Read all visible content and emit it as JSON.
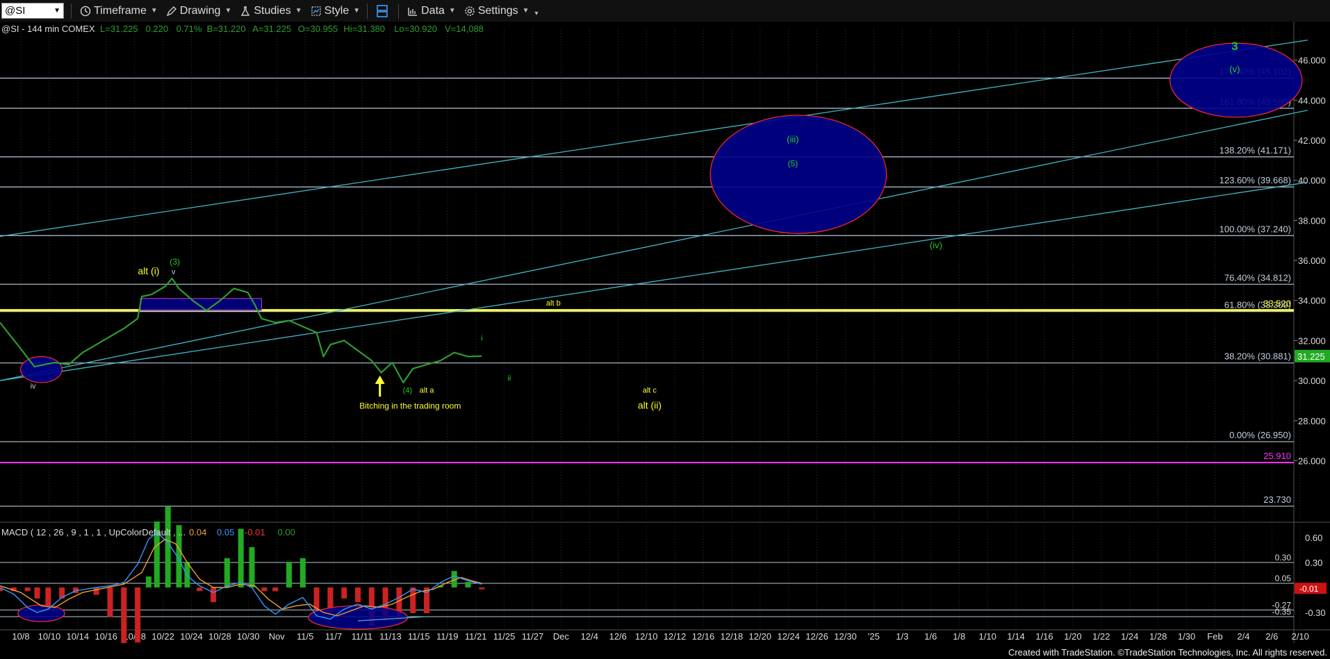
{
  "toolbar": {
    "symbol": "@SI",
    "timeframe_label": "Timeframe",
    "drawing_label": "Drawing",
    "studies_label": "Studies",
    "style_label": "Style",
    "data_label": "Data",
    "settings_label": "Settings"
  },
  "footer": "Created with TradeStation. ©TradeStation Technologies, Inc. All rights reserved.",
  "colors": {
    "bg": "#000000",
    "price": "#2e9e2e",
    "fib": "#b8c8d8",
    "channel": "#3fb8c8",
    "yellow": "#ffff33",
    "magenta": "#ff33ff",
    "ellipse_fill": "#00008b",
    "ellipse_stroke": "#ff2a2a",
    "macd": "#3399ff",
    "signal": "#f0a030"
  },
  "chart_data": [
    {
      "type": "line",
      "header": "@SI - 144 min  COMEX",
      "quote": [
        {
          "label": "L=31.225",
          "color": "#2e9e2e"
        },
        {
          "label": "0.220",
          "color": "#2e9e2e"
        },
        {
          "label": "0.71%",
          "color": "#2e9e2e"
        },
        {
          "label": "B=31.220",
          "color": "#2e9e2e"
        },
        {
          "label": "A=31.225",
          "color": "#2e9e2e"
        },
        {
          "label": "O=30.955",
          "color": "#2e9e2e"
        },
        {
          "label": "Hi=31.380",
          "color": "#2e9e2e"
        },
        {
          "label": "Lo=30.920",
          "color": "#2e9e2e"
        },
        {
          "label": "V=14,088",
          "color": "#2e9e2e"
        }
      ],
      "y_ticks": [
        "46.000",
        "44.000",
        "42.000",
        "40.000",
        "38.000",
        "36.000",
        "34.000",
        "32.000",
        "30.000",
        "28.000",
        "26.000"
      ],
      "ylim": [
        23.0,
        47.2
      ],
      "x_ticks": [
        "10/8",
        "10/10",
        "10/14",
        "10/16",
        "10/18",
        "10/22",
        "10/24",
        "10/28",
        "10/30",
        "Nov",
        "11/5",
        "11/7",
        "11/11",
        "11/13",
        "11/15",
        "11/19",
        "11/21",
        "11/25",
        "11/27",
        "Dec",
        "12/4",
        "12/6",
        "12/10",
        "12/12",
        "12/16",
        "12/18",
        "12/20",
        "12/24",
        "12/26",
        "12/30",
        "'25",
        "1/3",
        "1/6",
        "1/8",
        "1/10",
        "1/14",
        "1/16",
        "1/20",
        "1/22",
        "1/24",
        "1/28",
        "1/30",
        "Feb",
        "2/4",
        "2/6",
        "2/10"
      ],
      "last_price": "31.225",
      "price": [
        {
          "x": 0,
          "y": 32.9
        },
        {
          "x": 1.5,
          "y": 31.6
        },
        {
          "x": 2.5,
          "y": 30.7
        },
        {
          "x": 4,
          "y": 30.9
        },
        {
          "x": 5,
          "y": 30.8
        },
        {
          "x": 6,
          "y": 31.4
        },
        {
          "x": 7,
          "y": 31.8
        },
        {
          "x": 8,
          "y": 32.2
        },
        {
          "x": 9,
          "y": 32.6
        },
        {
          "x": 10,
          "y": 33.1
        },
        {
          "x": 10.3,
          "y": 34.2
        },
        {
          "x": 11,
          "y": 34.3
        },
        {
          "x": 12,
          "y": 34.7
        },
        {
          "x": 12.5,
          "y": 35.1
        },
        {
          "x": 13,
          "y": 34.6
        },
        {
          "x": 14,
          "y": 34.0
        },
        {
          "x": 15,
          "y": 33.5
        },
        {
          "x": 16,
          "y": 34.0
        },
        {
          "x": 17,
          "y": 34.6
        },
        {
          "x": 18,
          "y": 34.4
        },
        {
          "x": 18.5,
          "y": 33.8
        },
        {
          "x": 19,
          "y": 33.1
        },
        {
          "x": 20,
          "y": 32.9
        },
        {
          "x": 21,
          "y": 33.0
        },
        {
          "x": 22,
          "y": 32.7
        },
        {
          "x": 23,
          "y": 32.4
        },
        {
          "x": 23.5,
          "y": 31.2
        },
        {
          "x": 24,
          "y": 31.8
        },
        {
          "x": 25,
          "y": 32.0
        },
        {
          "x": 26,
          "y": 31.5
        },
        {
          "x": 27,
          "y": 31.0
        },
        {
          "x": 27.7,
          "y": 30.4
        },
        {
          "x": 28.5,
          "y": 30.9
        },
        {
          "x": 29.3,
          "y": 29.9
        },
        {
          "x": 30,
          "y": 30.6
        },
        {
          "x": 31,
          "y": 30.8
        },
        {
          "x": 32,
          "y": 31.0
        },
        {
          "x": 33,
          "y": 31.4
        },
        {
          "x": 34,
          "y": 31.2
        },
        {
          "x": 35,
          "y": 31.225
        }
      ],
      "horizontal_levels": [
        {
          "label": "176.40% (45.102)",
          "value": 45.102,
          "color": "#b8c8d8"
        },
        {
          "label": "161.80% (43.599)",
          "value": 43.599,
          "color": "#b8c8d8"
        },
        {
          "label": "138.20% (41.171)",
          "value": 41.171,
          "color": "#b8c8d8"
        },
        {
          "label": "123.60% (39.668)",
          "value": 39.668,
          "color": "#b8c8d8"
        },
        {
          "label": "100.00% (37.240)",
          "value": 37.24,
          "color": "#b8c8d8"
        },
        {
          "label": "76.40% (34.812)",
          "value": 34.812,
          "color": "#b8c8d8"
        },
        {
          "label": "61.80% (33.309)",
          "value": 33.45,
          "color": "#b8c8d8"
        },
        {
          "label": "38.20% (30.881)",
          "value": 30.881,
          "color": "#b8c8d8"
        },
        {
          "label": "0.00% (26.950)",
          "value": 26.95,
          "color": "#b8c8d8"
        },
        {
          "label": "33.520",
          "value": 33.52,
          "color": "#ffff33"
        },
        {
          "label": "25.910",
          "value": 25.91,
          "color": "#ff33ff"
        },
        {
          "label": "23.730",
          "value": 23.73,
          "color": "#b8c8d8"
        }
      ],
      "channel_lines": [
        {
          "x1": 0,
          "y1": 37.2,
          "x2": 95,
          "y2": 47.0
        },
        {
          "x1": 0,
          "y1": 30.0,
          "x2": 95,
          "y2": 43.5
        },
        {
          "x1": 0,
          "y1": 30.0,
          "x2": 95,
          "y2": 39.9
        }
      ],
      "ellipses": [
        {
          "cx": 3.0,
          "cy": 30.55,
          "rx": 1.5,
          "ry": 0.65
        },
        {
          "cx": 58.0,
          "cy": 40.3,
          "rx": 6.4,
          "ry": 2.95
        },
        {
          "cx": 89.8,
          "cy": 45.0,
          "rx": 4.8,
          "ry": 1.85
        }
      ],
      "rectangle": {
        "x1": 10.2,
        "x2": 19.0,
        "y1": 33.5,
        "y2": 34.1
      },
      "annotations": [
        {
          "text": "3",
          "x": 89.7,
          "y": 46.5,
          "color": "#22cc22",
          "size": 17,
          "bold": true
        },
        {
          "text": "(v)",
          "x": 89.7,
          "y": 45.4,
          "color": "#22cc22",
          "size": 13
        },
        {
          "text": "(iii)",
          "x": 57.6,
          "y": 41.9,
          "color": "#22cc22",
          "size": 13
        },
        {
          "text": "(5)",
          "x": 57.6,
          "y": 40.7,
          "color": "#22cc22",
          "size": 12
        },
        {
          "text": "(iv)",
          "x": 68.0,
          "y": 36.6,
          "color": "#22cc22",
          "size": 13
        },
        {
          "text": "alt (i)",
          "x": 10.8,
          "y": 35.3,
          "color": "#ffff33",
          "size": 14
        },
        {
          "text": "(3)",
          "x": 12.7,
          "y": 35.8,
          "color": "#22cc22",
          "size": 12
        },
        {
          "text": "v",
          "x": 12.6,
          "y": 35.3,
          "color": "#ccc",
          "size": 11
        },
        {
          "text": "alt b",
          "x": 40.2,
          "y": 33.75,
          "color": "#ffff33",
          "size": 11
        },
        {
          "text": "i",
          "x": 35.0,
          "y": 32.0,
          "color": "#22cc22",
          "size": 11
        },
        {
          "text": "ii",
          "x": 37.0,
          "y": 30.0,
          "color": "#22cc22",
          "size": 11
        },
        {
          "text": "iv",
          "x": 2.4,
          "y": 29.6,
          "color": "#ccc",
          "size": 11
        },
        {
          "text": "(4)",
          "x": 29.6,
          "y": 29.4,
          "color": "#22cc22",
          "size": 11
        },
        {
          "text": "alt a",
          "x": 31.0,
          "y": 29.4,
          "color": "#ffff33",
          "size": 11
        },
        {
          "text": "alt c",
          "x": 47.2,
          "y": 29.4,
          "color": "#ffff33",
          "size": 11
        },
        {
          "text": "alt (ii)",
          "x": 47.2,
          "y": 28.6,
          "color": "#ffff33",
          "size": 14
        },
        {
          "text": "Bitching in the trading room",
          "x": 29.8,
          "y": 28.6,
          "color": "#ffff33",
          "size": 12
        }
      ],
      "arrow": {
        "x": 27.6,
        "y_from": 29.2,
        "y_to": 30.25
      }
    },
    {
      "type": "line",
      "header": "MACD ( 12 , 26 , 9 , 1 , 1 , UpColorDefault , ...",
      "readouts": [
        {
          "label": "0.04",
          "color": "#f0a030"
        },
        {
          "label": "0.05",
          "color": "#3399ff"
        },
        {
          "label": "-0.01",
          "color": "#ff3333"
        },
        {
          "label": "0.00",
          "color": "#2e9e2e"
        }
      ],
      "y_ticks": [
        "0.60",
        "0.30",
        "-0.30"
      ],
      "ylim": [
        -0.45,
        0.75
      ],
      "levels": [
        {
          "label": "0.30",
          "value": 0.3
        },
        {
          "label": "0.05",
          "value": 0.05
        },
        {
          "label": "-0.27",
          "value": -0.27
        },
        {
          "label": "-0.35",
          "value": -0.35
        }
      ],
      "last_value": "-0.01",
      "macd": [
        {
          "x": 0,
          "y": 0.0
        },
        {
          "x": 1,
          "y": -0.08
        },
        {
          "x": 2,
          "y": -0.24
        },
        {
          "x": 2.7,
          "y": -0.3
        },
        {
          "x": 3.5,
          "y": -0.26
        },
        {
          "x": 4.5,
          "y": -0.12
        },
        {
          "x": 5.5,
          "y": -0.04
        },
        {
          "x": 7,
          "y": 0.0
        },
        {
          "x": 8,
          "y": 0.02
        },
        {
          "x": 9,
          "y": 0.06
        },
        {
          "x": 10,
          "y": 0.28
        },
        {
          "x": 10.8,
          "y": 0.58
        },
        {
          "x": 11.4,
          "y": 0.66
        },
        {
          "x": 12.2,
          "y": 0.54
        },
        {
          "x": 13,
          "y": 0.34
        },
        {
          "x": 13.6,
          "y": 0.14
        },
        {
          "x": 14.5,
          "y": 0.02
        },
        {
          "x": 15.5,
          "y": -0.06
        },
        {
          "x": 16.5,
          "y": 0.02
        },
        {
          "x": 17.5,
          "y": 0.06
        },
        {
          "x": 18.3,
          "y": 0.0
        },
        {
          "x": 19.2,
          "y": -0.22
        },
        {
          "x": 20,
          "y": -0.32
        },
        {
          "x": 21,
          "y": -0.2
        },
        {
          "x": 22,
          "y": -0.12
        },
        {
          "x": 23,
          "y": -0.34
        },
        {
          "x": 24,
          "y": -0.38
        },
        {
          "x": 25,
          "y": -0.26
        },
        {
          "x": 26,
          "y": -0.2
        },
        {
          "x": 27,
          "y": -0.26
        },
        {
          "x": 28,
          "y": -0.2
        },
        {
          "x": 29,
          "y": -0.12
        },
        {
          "x": 30,
          "y": -0.02
        },
        {
          "x": 31,
          "y": -0.06
        },
        {
          "x": 32,
          "y": 0.06
        },
        {
          "x": 33,
          "y": 0.14
        },
        {
          "x": 34,
          "y": 0.08
        },
        {
          "x": 35,
          "y": 0.04
        }
      ],
      "signal": [
        {
          "x": 0,
          "y": 0.02
        },
        {
          "x": 1.5,
          "y": -0.06
        },
        {
          "x": 3,
          "y": -0.22
        },
        {
          "x": 4,
          "y": -0.24
        },
        {
          "x": 5,
          "y": -0.14
        },
        {
          "x": 6,
          "y": -0.06
        },
        {
          "x": 7.5,
          "y": -0.01
        },
        {
          "x": 9,
          "y": 0.04
        },
        {
          "x": 10.3,
          "y": 0.18
        },
        {
          "x": 11.2,
          "y": 0.48
        },
        {
          "x": 12,
          "y": 0.58
        },
        {
          "x": 12.8,
          "y": 0.52
        },
        {
          "x": 13.6,
          "y": 0.3
        },
        {
          "x": 14.5,
          "y": 0.1
        },
        {
          "x": 15.5,
          "y": 0.0
        },
        {
          "x": 16.5,
          "y": 0.0
        },
        {
          "x": 17.5,
          "y": 0.04
        },
        {
          "x": 18.5,
          "y": 0.02
        },
        {
          "x": 19.5,
          "y": -0.14
        },
        {
          "x": 20.5,
          "y": -0.26
        },
        {
          "x": 21.5,
          "y": -0.22
        },
        {
          "x": 22.5,
          "y": -0.2
        },
        {
          "x": 23.5,
          "y": -0.3
        },
        {
          "x": 24.5,
          "y": -0.34
        },
        {
          "x": 25.5,
          "y": -0.28
        },
        {
          "x": 26.5,
          "y": -0.22
        },
        {
          "x": 27.5,
          "y": -0.24
        },
        {
          "x": 28.5,
          "y": -0.2
        },
        {
          "x": 29.5,
          "y": -0.12
        },
        {
          "x": 30.5,
          "y": -0.05
        },
        {
          "x": 31.5,
          "y": -0.02
        },
        {
          "x": 32.5,
          "y": 0.06
        },
        {
          "x": 33.5,
          "y": 0.12
        },
        {
          "x": 34.3,
          "y": 0.08
        },
        {
          "x": 35,
          "y": 0.05
        }
      ],
      "ellipses": [
        {
          "cx": 3.0,
          "cy": -0.31,
          "rx": 1.7,
          "ry": 0.1
        },
        {
          "cx": 26.0,
          "cy": -0.36,
          "rx": 3.6,
          "ry": 0.14
        }
      ],
      "trend_line": {
        "x1": 26.0,
        "y1": -0.4,
        "x2": 31.0,
        "y2": -0.35
      }
    }
  ]
}
